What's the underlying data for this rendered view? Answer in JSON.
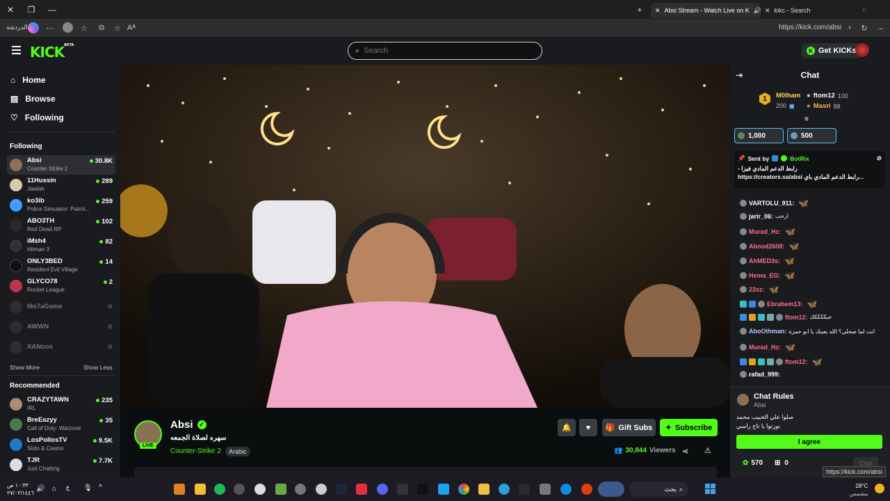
{
  "browser": {
    "tabs": [
      {
        "label": "Absi Stream - Watch Live on K"
      },
      {
        "label": "kikc - Search"
      }
    ],
    "profile_label": "الدردشة",
    "address": "https://kick.com/absi",
    "status_url": "https://kick.com/absi"
  },
  "header": {
    "logo": "KICK",
    "logo_badge": "BETA",
    "search_placeholder": "Search",
    "get_kicks_label": "Get KICKs"
  },
  "sidebar": {
    "nav": [
      {
        "label": "Home",
        "icon": "home-icon"
      },
      {
        "label": "Browse",
        "icon": "browse-icon"
      },
      {
        "label": "Following",
        "icon": "heart-icon"
      }
    ],
    "following_title": "Following",
    "following": [
      {
        "name": "Absi",
        "game": "Counter-Strike 2",
        "viewers": "30.8K",
        "color": "#8a7152"
      },
      {
        "name": "11Hussin",
        "game": "Jawlah",
        "viewers": "289",
        "color": "#d9c9b0"
      },
      {
        "name": "ko3ib",
        "game": "Police Simulator: Patrol...",
        "viewers": "259",
        "color": "#3fa0ff"
      },
      {
        "name": "ABO3TH",
        "game": "Red Dead RP",
        "viewers": "102",
        "color": "#222222"
      },
      {
        "name": "iMsh4",
        "game": "Hitman 3",
        "viewers": "82",
        "color": "#333333"
      },
      {
        "name": "ONLY3BED",
        "game": "Resident Evil Village",
        "viewers": "14",
        "color": "#111111"
      },
      {
        "name": "GLYCO78",
        "game": "Rocket League",
        "viewers": "2",
        "color": "#c0324e"
      }
    ],
    "offline": [
      {
        "name": "Mo7aGame"
      },
      {
        "name": "AWWN"
      },
      {
        "name": "XANoos"
      }
    ],
    "show_more": "Show More",
    "show_less": "Show Less",
    "recommended_title": "Recommended",
    "recommended": [
      {
        "name": "CRAZYTAWN",
        "game": "IRL",
        "viewers": "235",
        "color": "#b08a70"
      },
      {
        "name": "BreEazyy",
        "game": "Call of Duty: Warzone",
        "viewers": "35",
        "color": "#4a7a52"
      },
      {
        "name": "LosPollosTV",
        "game": "Slots & Casino",
        "viewers": "9.5K",
        "color": "#1e7ac9"
      },
      {
        "name": "TJR",
        "game": "Just Chatting",
        "viewers": "7.7K",
        "color": "#dddddd"
      }
    ]
  },
  "stream": {
    "name": "Absi",
    "live_label": "LIVE",
    "title": "سهره لصلاة الجمعه",
    "game": "Counter-Strike 2",
    "tag": "Arabic",
    "gift_subs": "Gift Subs",
    "subscribe": "Subscribe",
    "viewers": "30,844",
    "viewers_label": "Viewers"
  },
  "chat": {
    "title": "Chat",
    "leaderboard": [
      {
        "rank": "1",
        "name": "M0lham",
        "count": "200"
      },
      {
        "name": "ftom12",
        "count": "100"
      },
      {
        "name": "Masri",
        "count": "88"
      }
    ],
    "kicks": [
      {
        "amount": "1,000"
      },
      {
        "amount": "500"
      }
    ],
    "pinned": {
      "sent_by": "Sent by",
      "sender": "BotRix",
      "line1": "- رابط الدعم المادي فيزا",
      "line2": "https://creators.sa/absi رابط الدعم المادي باي..."
    },
    "messages": [
      {
        "user": "VARTOLU_911:",
        "text": "",
        "color": "#ffffff",
        "butterfly": true
      },
      {
        "user": "jarir_06:",
        "text": "ارحب",
        "color": "#ffffff",
        "butterfly": false
      },
      {
        "user": "Murad_Hz:",
        "text": "",
        "color": "#ff6b8a",
        "butterfly": true
      },
      {
        "user": "Abood2608:",
        "text": "",
        "color": "#ff6b8a",
        "butterfly": true
      },
      {
        "user": "AhMED3s:",
        "text": "",
        "color": "#ff6b8a",
        "butterfly": true
      },
      {
        "user": "Hema_EG:",
        "text": "",
        "color": "#ff6b8a",
        "butterfly": true
      },
      {
        "user": "22xz:",
        "text": "",
        "color": "#ff6b8a",
        "butterfly": true
      },
      {
        "user": "Ebrahem13:",
        "text": "",
        "color": "#ff6b8a",
        "butterfly": true
      },
      {
        "user": "ftom12:",
        "text": "حبككككك",
        "color": "#ff6b8a",
        "butterfly": false
      },
      {
        "user": "AboOthman:",
        "text": "انت لما صحلي؟ الله يعينك يا ابو حمزة",
        "color": "#b0c8ff",
        "butterfly": false
      },
      {
        "user": "Murad_Hz:",
        "text": "",
        "color": "#ff6b8a",
        "butterfly": true
      },
      {
        "user": "ftom12:",
        "text": "",
        "color": "#ff6b8a",
        "butterfly": true
      },
      {
        "user": "rafad_999:",
        "text": "",
        "color": "#ffffff",
        "butterfly": false
      }
    ],
    "rules_title": "Chat Rules",
    "rules_channel": "Absi",
    "rules_line1": "صلوا علي الحبيب محمد",
    "rules_line2": "نورتوا يا تاج راسي",
    "agree_label": "I agree",
    "kicks_balance": "570",
    "gift_count": "0",
    "chat_button": "Chat"
  },
  "taskbar": {
    "time": "١٠:٣٢ ص",
    "date": "٢٧/٠٢/١٤٤٦",
    "weather_temp": "28°C",
    "weather_desc": "مشمس",
    "search_label": "بحث",
    "lang": "ع"
  },
  "colors": {
    "kick_green": "#53fc18",
    "panel": "#191b1f",
    "background": "#0b0e0f"
  }
}
